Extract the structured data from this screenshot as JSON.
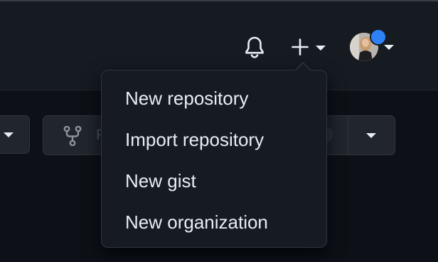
{
  "header": {
    "notifications_icon": "bell-icon",
    "create_icon": "plus-icon",
    "avatar_alt": "user-avatar",
    "notification_dot_color": "#2f81f7"
  },
  "create_menu": {
    "items": [
      {
        "label": "New repository"
      },
      {
        "label": "Import repository"
      },
      {
        "label": "New gist"
      },
      {
        "label": "New organization"
      }
    ]
  },
  "repo_actions": {
    "fork_label": "F",
    "fork_icon": "repo-forked-icon"
  },
  "colors": {
    "header_bg": "#161b22",
    "page_bg": "#0d1117",
    "menu_border": "#30363d",
    "text": "#e6edf3"
  }
}
